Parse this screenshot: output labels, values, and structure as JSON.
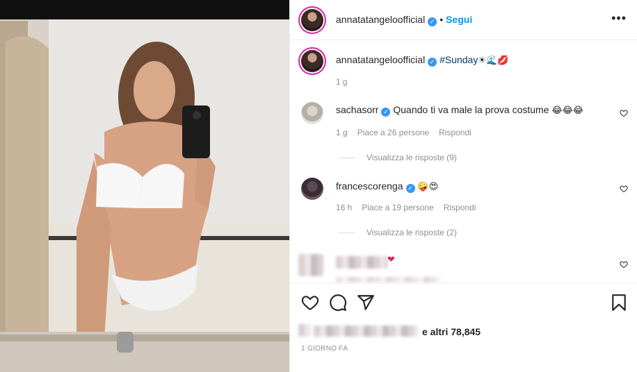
{
  "post": {
    "username": "annatatangeloofficial",
    "follow_label": "Segui",
    "separator": "•",
    "more_label": "•••",
    "photo_alt": ""
  },
  "caption": {
    "username": "annatatangeloofficial",
    "text": "#Sunday",
    "emojis": "☀🌊💋",
    "time": "1 g"
  },
  "comments": [
    {
      "username": "sachasorr",
      "text": "Quando ti va male la prova costume",
      "emojis": "😂😂😂",
      "time": "1 g",
      "likes": "Piace a 26 persone",
      "reply": "Rispondi",
      "view_replies": "Visualizza le risposte (9)"
    },
    {
      "username": "francescorenga",
      "text": "",
      "emojis": "🤪😍",
      "time": "16 h",
      "likes": "Piace a 19 persone",
      "reply": "Rispondi",
      "view_replies": "Visualizza le risposte (2)"
    },
    {
      "username": "",
      "text": "",
      "emojis": "❤",
      "time": "",
      "likes": "",
      "reply": "",
      "view_replies": ""
    }
  ],
  "footer": {
    "likes_suffix": "e altri 78,845",
    "timestamp": "1 GIORNO FA"
  },
  "icons": {
    "like": "heart-icon",
    "comment": "comment-icon",
    "share": "share-icon",
    "save": "bookmark-icon"
  },
  "colors": {
    "accent": "#0095f6",
    "verified": "#3897f0",
    "muted": "#8e8e8e"
  }
}
